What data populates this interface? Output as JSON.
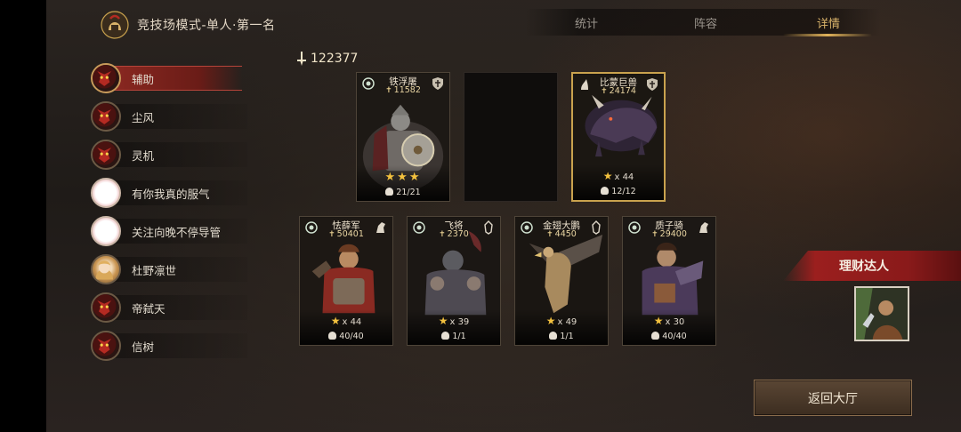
{
  "header": {
    "title": "竞技场模式-单人·第一名"
  },
  "tabs": [
    {
      "label": "统计",
      "active": false
    },
    {
      "label": "阵容",
      "active": false
    },
    {
      "label": "详情",
      "active": true
    }
  ],
  "sidebar": {
    "items": [
      {
        "label": "辅助",
        "avatar": "demon-mask-icon",
        "active": true
      },
      {
        "label": "尘风",
        "avatar": "demon-mask-icon",
        "active": false
      },
      {
        "label": "灵机",
        "avatar": "demon-mask-icon",
        "active": false
      },
      {
        "label": "有你我真的服气",
        "avatar": "blank-avatar",
        "active": false
      },
      {
        "label": "关注向晚不停导管",
        "avatar": "blank-avatar",
        "active": false
      },
      {
        "label": "杜野凛世",
        "avatar": "anime-girl-avatar",
        "active": false
      },
      {
        "label": "帝弑天",
        "avatar": "demon-mask-icon",
        "active": false
      },
      {
        "label": "信树",
        "avatar": "demon-mask-icon",
        "active": false
      }
    ]
  },
  "power": {
    "value": "122377",
    "icon": "power-sword-icon"
  },
  "units": {
    "top": [
      {
        "name": "铁浮屠",
        "power": "11582",
        "stars": "★★★",
        "troops": "21/21",
        "frame": "plain",
        "art": "armored-cavalry"
      },
      {
        "empty": true
      },
      {
        "name": "比蒙巨兽",
        "power": "24174",
        "star_count": "x 44",
        "troops": "12/12",
        "frame": "gold",
        "art": "behemoth"
      }
    ],
    "bottom": [
      {
        "name": "怯薛军",
        "power": "50401",
        "star_count": "x 44",
        "troops": "40/40",
        "art": "keshig-guard"
      },
      {
        "name": "飞将",
        "power": "2370",
        "star_count": "x 39",
        "troops": "1/1",
        "art": "flying-general"
      },
      {
        "name": "金翅大鹏",
        "power": "4450",
        "star_count": "x 49",
        "troops": "1/1",
        "art": "golden-garuda"
      },
      {
        "name": "质子骑",
        "power": "29400",
        "star_count": "x 30",
        "troops": "40/40",
        "art": "hostage-rider"
      }
    ]
  },
  "player": {
    "name": "理财达人",
    "avatar": "player-portrait"
  },
  "back_button": {
    "label": "返回大厅"
  },
  "colors": {
    "accent_gold": "#d9b36a",
    "banner_red": "#9b1f1e",
    "star": "#f3c13e"
  }
}
